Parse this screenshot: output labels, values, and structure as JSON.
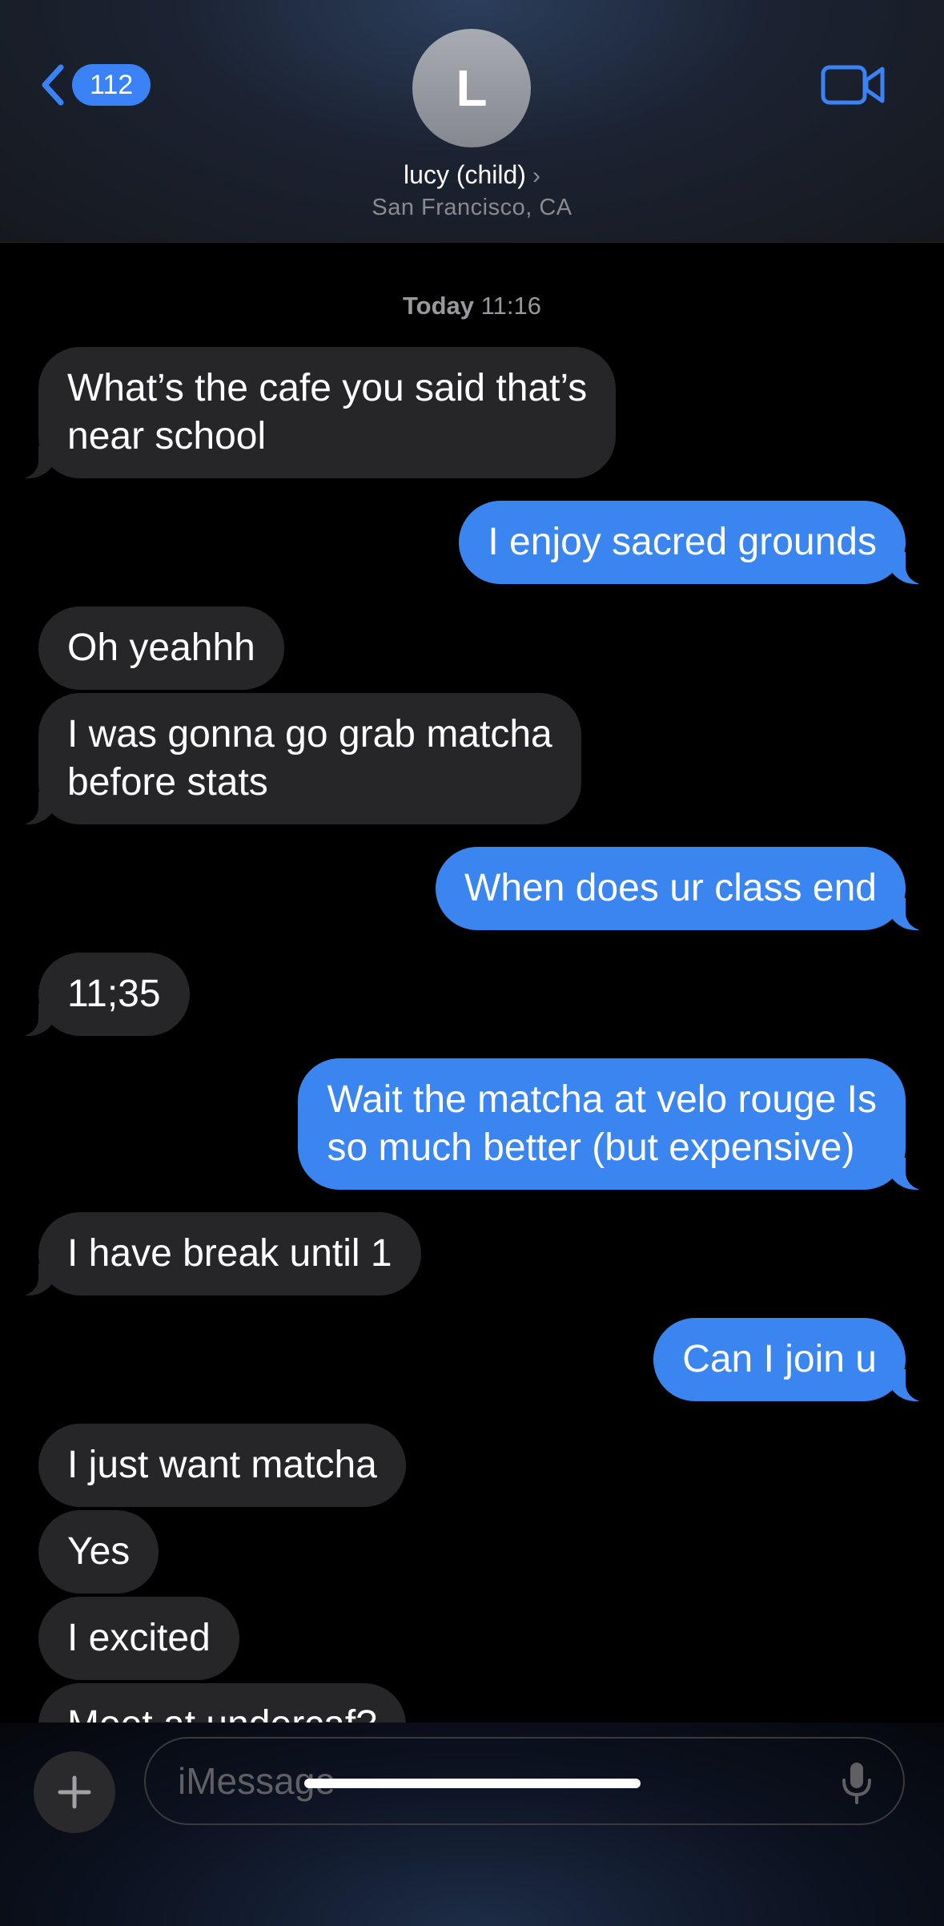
{
  "header": {
    "back_count": "112",
    "avatar_initial": "L",
    "contact_name": "lucy (child)",
    "contact_location": "San Francisco, CA"
  },
  "thread": {
    "timestamp_day": "Today",
    "timestamp_time": "11:16",
    "messages": [
      {
        "from": "them",
        "lines": [
          "What’s the cafe you said that’s",
          "near school"
        ]
      },
      {
        "from": "me",
        "lines": [
          "I enjoy sacred grounds"
        ]
      },
      {
        "from": "them",
        "lines": [
          "Oh yeahhh"
        ]
      },
      {
        "from": "them",
        "lines": [
          "I was gonna go grab matcha",
          "before stats"
        ]
      },
      {
        "from": "me",
        "lines": [
          "When does ur class end"
        ]
      },
      {
        "from": "them",
        "lines": [
          "11;35"
        ]
      },
      {
        "from": "me",
        "lines": [
          "Wait the matcha at velo rouge Is",
          "so much better (but expensive)"
        ]
      },
      {
        "from": "them",
        "lines": [
          "I have break until 1"
        ]
      },
      {
        "from": "me",
        "lines": [
          "Can I join u"
        ]
      },
      {
        "from": "them",
        "lines": [
          "I just want matcha"
        ]
      },
      {
        "from": "them",
        "lines": [
          "Yes"
        ]
      },
      {
        "from": "them",
        "lines": [
          "I excited"
        ]
      },
      {
        "from": "them",
        "lines": [
          "Meet at undercaf?"
        ]
      }
    ]
  },
  "compose": {
    "placeholder": "iMessage"
  },
  "colors": {
    "accent": "#3b82f6",
    "outgoing_bubble": "#3b85f0",
    "incoming_bubble": "#262628"
  }
}
